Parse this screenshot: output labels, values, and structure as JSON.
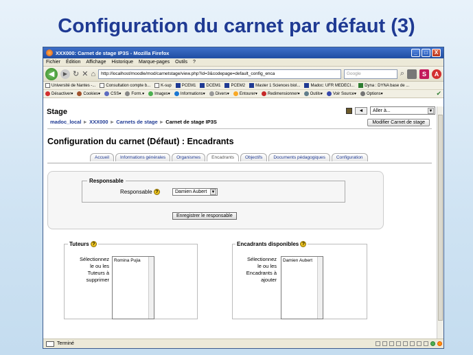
{
  "slide": {
    "title": "Configuration du carnet par défaut (3)"
  },
  "window": {
    "title": "XXX000: Carnet de stage IP3S - Mozilla Firefox",
    "controls": {
      "minimize": "_",
      "maximize": "□",
      "close": "X"
    }
  },
  "menu": [
    "Fichier",
    "Édition",
    "Affichage",
    "Historique",
    "Marque-pages",
    "Outils",
    "?"
  ],
  "nav": {
    "back": "◀",
    "forward": "▶",
    "url": "http://localhost/moodle/mod/carnetstage/view.php?id=3&codepage=default_config_enca",
    "search_placeholder": "Google"
  },
  "bookmarks": [
    "Université de Nantes -...",
    "Consultation compte b...",
    "K-sup",
    "PCEM1",
    "DCEM1",
    "PCEM2",
    "Master 1 Sciences biol...",
    "Madoc: UFR MEDECI...",
    "Dyna : DYNA base de ..."
  ],
  "devtools": [
    "Désactiver▾",
    "Cookies▾",
    "CSS▾",
    "Form.▾",
    "Images▾",
    "Informations▾",
    "Divers▾",
    "Entourer▾",
    "Redimensionner▾",
    "Outils▾",
    "Voir Source▾",
    "Options▾"
  ],
  "page": {
    "stage_header": "Stage",
    "jump": {
      "button": "◄",
      "value": "Aller à..."
    },
    "breadcrumb": {
      "sep": "►",
      "items": [
        "madoc_local",
        "XXX000",
        "Carnets de stage",
        "Carnet de stage IP3S"
      ]
    },
    "modify_button": "Modifier Carnet de stage",
    "title": "Configuration du carnet (Défaut) : Encadrants",
    "tabs": [
      "Accueil",
      "Informations générales",
      "Organismes",
      "Encadrants",
      "Objectifs",
      "Documents pédagogiques",
      "Configuration"
    ],
    "responsable": {
      "legend": "Responsable",
      "label": "Responsable",
      "selected": "Damien Aubert",
      "save_button": "Enregistrer le responsable"
    },
    "tuteurs": {
      "title": "Tuteurs",
      "desc": [
        "Sélectionnez",
        "le ou les",
        "Tuteurs à",
        "supprimer"
      ],
      "items": [
        "Romina Pujia"
      ]
    },
    "encadrants": {
      "title": "Encadrants disponibles",
      "desc": [
        "Sélectionnez",
        "le ou les",
        "Encadrants à",
        "ajouter"
      ],
      "items": [
        "Damien Aubert"
      ]
    }
  },
  "status": {
    "text": "Terminé"
  }
}
